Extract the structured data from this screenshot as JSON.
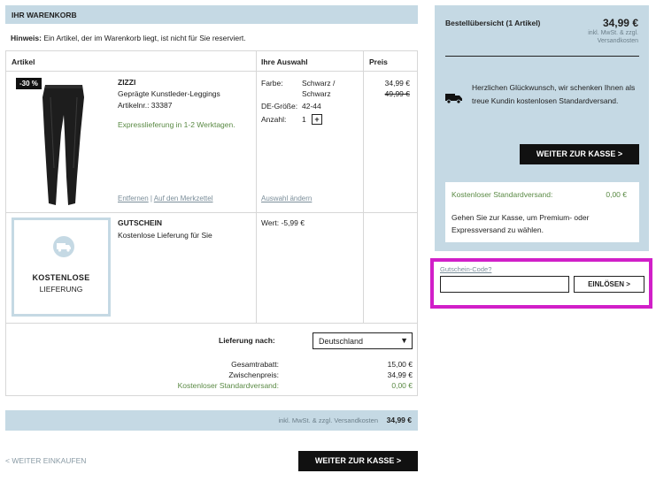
{
  "cart": {
    "header": "IHR WARENKORB",
    "notice_label": "Hinweis:",
    "notice_text": " Ein Artikel, der im Warenkorb liegt, ist nicht für Sie reserviert.",
    "columns": [
      "Artikel",
      "Ihre Auswahl",
      "Preis"
    ],
    "product": {
      "badge": "-30 %",
      "brand": "ZIZZI",
      "name": "Geprägte Kunstleder-Leggings",
      "article_no": "Artikelnr.: 33387",
      "delivery": "Expresslieferung in 1-2 Werktagen.",
      "remove": "Entfernen",
      "link_sep": " | ",
      "wishlist": "Auf den Merkzettel",
      "color_label": "Farbe:",
      "color_value_1": "Schwarz /",
      "color_value_2": "Schwarz",
      "size_label": "DE-Größe:",
      "size_value": "42-44",
      "qty_label": "Anzahl:",
      "qty_value": "1",
      "qty_plus": "+",
      "change_selection": "Auswahl ändern",
      "price_now": "34,99 €",
      "price_old": "49,99 €"
    },
    "voucher": {
      "card_line1": "KOSTENLOSE",
      "card_line2": "LIEFERUNG",
      "title": "GUTSCHEIN",
      "description": "Kostenlose Lieferung für Sie",
      "value": "Wert: -5,99 €"
    },
    "shipping_label": "Lieferung nach:",
    "shipping_country": "Deutschland",
    "totals": [
      {
        "label": "Gesamtrabatt:",
        "value": "15,00 €"
      },
      {
        "label": "Zwischenpreis:",
        "value": "34,99 €"
      },
      {
        "label": "Kostenloser Standardversand:",
        "value": "0,00 €"
      }
    ],
    "bottom_note": "inkl. MwSt. & zzgl. Versandkosten",
    "bottom_total": "34,99 €",
    "continue_shopping": "< WEITER EINKAUFEN",
    "checkout": "WEITER ZUR KASSE >"
  },
  "overview": {
    "title": "Bestellübersicht (1 Artikel)",
    "price": "34,99 €",
    "tax_note_1": "inkl. MwSt. & zzgl.",
    "tax_note_2": "Versandkosten",
    "message": "Herzlichen Glückwunsch, wir schenken Ihnen als treue Kundin kostenlosen Standardversand.",
    "checkout": "WEITER ZUR KASSE >",
    "shipping_label": "Kostenloser Standardversand:",
    "shipping_value": "0,00 €",
    "shipping_message": "Gehen Sie zur Kasse, um Premium- oder Expressversand zu wählen."
  },
  "coupon": {
    "link": "Gutschein-Code?",
    "input_value": "",
    "button": "EINLÖSEN >"
  },
  "colors": {
    "panel_blue": "#c5d9e4",
    "highlight_magenta": "#d11fc8",
    "green_text": "#5a8a44"
  },
  "icons": {
    "truck": "truck-icon",
    "dropdown": "chevron-down-icon"
  }
}
